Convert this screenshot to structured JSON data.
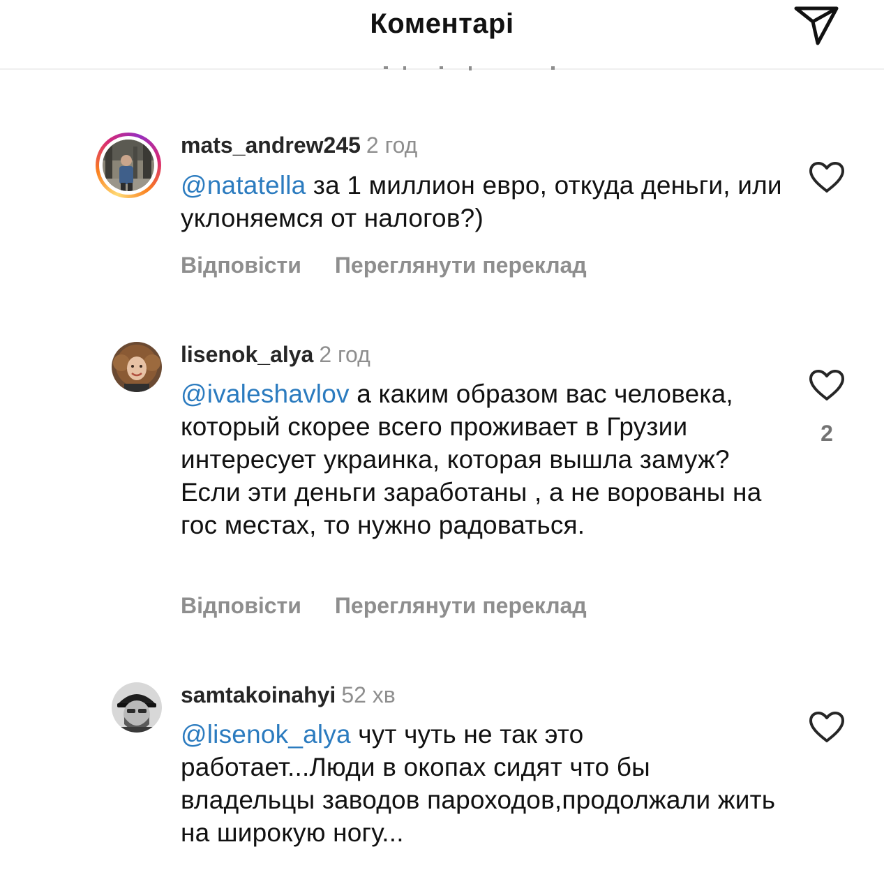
{
  "header": {
    "title": "Коментарі",
    "send_icon": "paper-plane-icon"
  },
  "comments": [
    {
      "username": "mats_andrew245",
      "time": "2 год",
      "mention": "@natatella",
      "text": " за 1 миллион евро, откуда деньги, или уклоняемся от налогов?)",
      "reply_label": "Відповісти",
      "translate_label": "Переглянути переклад",
      "likes": "",
      "has_story_ring": true
    },
    {
      "username": "lisenok_alya",
      "time": "2 год",
      "mention": "@ivaleshavlov",
      "text": " а каким образом вас человека, который скорее всего проживает в Грузии интересует украинка, которая вышла замуж? Если эти деньги заработаны , а не ворованы на гос местах,  то нужно радоваться.",
      "reply_label": "Відповісти",
      "translate_label": "Переглянути переклад",
      "likes": "2",
      "has_story_ring": false
    },
    {
      "username": "samtakoinahyi",
      "time": "52 хв",
      "mention": "@lisenok_alya",
      "text": " чут чуть не так это работает...Люди в окопах сидят что бы владельцы заводов пароходов,продолжали жить на широкую ногу...",
      "reply_label": "",
      "translate_label": "",
      "likes": "",
      "has_story_ring": false
    }
  ],
  "icons": {
    "like": "heart-outline-icon",
    "colors": {
      "mention": "#2b7bbf",
      "muted": "#8e8e8e",
      "text": "#111111"
    }
  }
}
